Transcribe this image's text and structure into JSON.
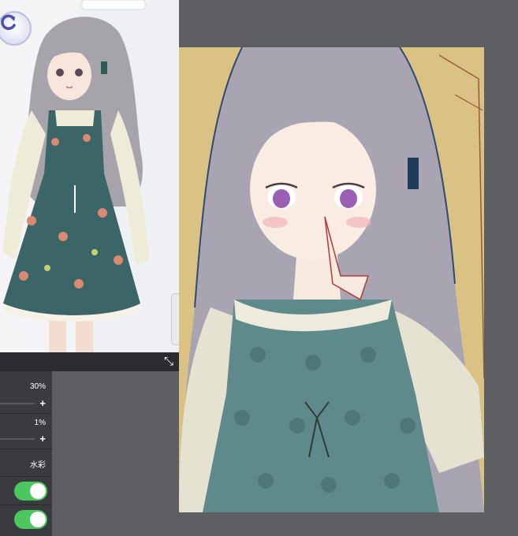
{
  "brush_settings": {
    "opacity_value": "30%",
    "second_value": "1%",
    "brush_type": "水彩",
    "toggles": [
      {
        "on": true
      },
      {
        "on": true
      }
    ],
    "plus_symbol": "+"
  },
  "icons": {
    "refresh": "refresh-icon",
    "resize": "resize-diagonal-icon"
  },
  "colors": {
    "canvas_background": "#d9c283",
    "workspace": "#5d5f63",
    "toggle_on": "#4cc65f"
  }
}
